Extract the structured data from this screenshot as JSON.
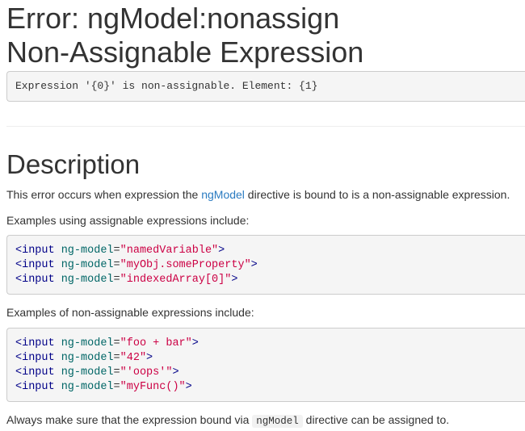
{
  "header": {
    "title_line1": "Error: ngModel:nonassign",
    "title_line2": "Non-Assignable Expression"
  },
  "error_message": "Expression '{0}' is non-assignable. Element: {1}",
  "description": {
    "heading": "Description",
    "intro_before": "This error occurs when expression the ",
    "intro_link": "ngModel",
    "intro_after": " directive is bound to is a non-assignable expression.",
    "assignable_label": "Examples using assignable expressions include:",
    "assignable_examples": [
      {
        "tag": "<input",
        "attr": " ng-model",
        "eq": "=",
        "value": "\"namedVariable\"",
        "close": ">"
      },
      {
        "tag": "<input",
        "attr": " ng-model",
        "eq": "=",
        "value": "\"myObj.someProperty\"",
        "close": ">"
      },
      {
        "tag": "<input",
        "attr": " ng-model",
        "eq": "=",
        "value": "\"indexedArray[0]\"",
        "close": ">"
      }
    ],
    "nonassignable_label": "Examples of non-assignable expressions include:",
    "nonassignable_examples": [
      {
        "tag": "<input",
        "attr": " ng-model",
        "eq": "=",
        "value": "\"foo + bar\"",
        "close": ">"
      },
      {
        "tag": "<input",
        "attr": " ng-model",
        "eq": "=",
        "value": "\"42\"",
        "close": ">"
      },
      {
        "tag": "<input",
        "attr": " ng-model",
        "eq": "=",
        "value": "\"'oops'\"",
        "close": ">"
      },
      {
        "tag": "<input",
        "attr": " ng-model",
        "eq": "=",
        "value": "\"myFunc()\"",
        "close": ">"
      }
    ],
    "closing_before": "Always make sure that the expression bound via ",
    "closing_code": "ngModel",
    "closing_after": " directive can be assigned to."
  }
}
